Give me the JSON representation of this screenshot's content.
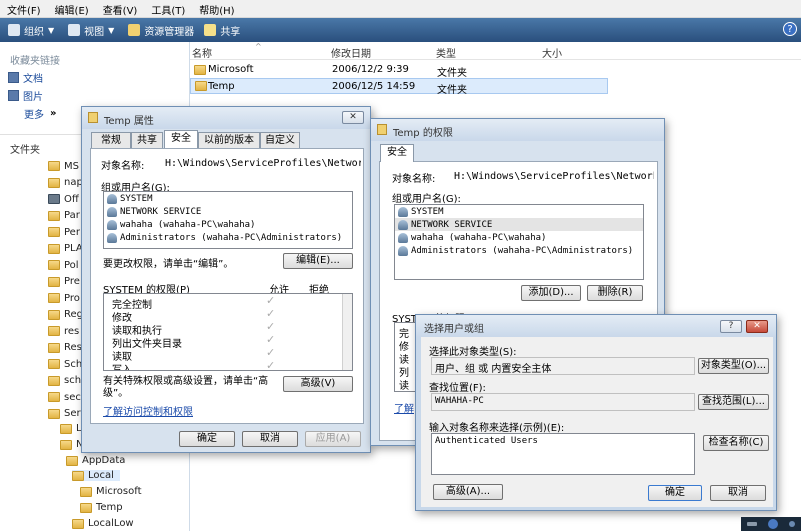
{
  "menubar": [
    "文件(F)",
    "编辑(E)",
    "查看(V)",
    "工具(T)",
    "帮助(H)"
  ],
  "toolbar": {
    "organize": "组织",
    "views": "视图",
    "explorer": "资源管理器",
    "share": "共享",
    "help": "?"
  },
  "left": {
    "favorites_header": "收藏夹链接",
    "favorites": [
      "文档",
      "图片",
      "更多"
    ],
    "more_arrows": "»",
    "folders_header": "文件夹",
    "tree": [
      "MS",
      "nap",
      "Off",
      "Par",
      "Per",
      "PLA",
      "Pol",
      "Pre",
      "Pro",
      "Reg",
      "res",
      "Res",
      "Sch",
      "sch",
      "sec",
      "Ser",
      "Lo",
      "N",
      "AppData",
      "Local",
      "Microsoft",
      "Temp",
      "LocalLow"
    ]
  },
  "filelist": {
    "columns": [
      "名称",
      "修改日期",
      "类型",
      "大小"
    ],
    "rows": [
      {
        "name": "Microsoft",
        "date": "2006/12/2 9:39",
        "type": "文件夹"
      },
      {
        "name": "Temp",
        "date": "2006/12/5 14:59",
        "type": "文件夹"
      }
    ]
  },
  "props": {
    "title": "Temp 属性",
    "close": "✕",
    "tabs": [
      "常规",
      "共享",
      "安全",
      "以前的版本",
      "自定义"
    ],
    "object_label": "对象名称:",
    "object_value": "H:\\Windows\\ServiceProfiles\\NetworkServic",
    "group_label": "组或用户名(G):",
    "users": [
      "SYSTEM",
      "NETWORK SERVICE",
      "wahaha (wahaha-PC\\wahaha)",
      "Administrators (wahaha-PC\\Administrators)"
    ],
    "change_text": "要更改权限，请单击“编辑”。",
    "edit_btn": "编辑(E)...",
    "perm_header": "SYSTEM 的权限(P)",
    "allow": "允许",
    "deny": "拒绝",
    "perms": [
      "完全控制",
      "修改",
      "读取和执行",
      "列出文件夹目录",
      "读取",
      "写入"
    ],
    "check": "✓",
    "advanced_text": "有关特殊权限或高级设置，请单击“高级”。",
    "advanced_btn": "高级(V)",
    "learn_link": "了解访问控制和权限",
    "ok": "确定",
    "cancel": "取消",
    "apply": "应用(A)"
  },
  "perm": {
    "title": "Temp 的权限",
    "tab": "安全",
    "object_label": "对象名称:",
    "object_value": "H:\\Windows\\ServiceProfiles\\NetworkServic",
    "group_label": "组或用户名(G):",
    "users": [
      "SYSTEM",
      "NETWORK SERVICE",
      "wahaha (wahaha-PC\\wahaha)",
      "Administrators (wahaha-PC\\Administrators)"
    ],
    "add_btn": "添加(D)...",
    "remove_btn": "删除(R)",
    "perm_header_partial": "SYSTEM 的权限",
    "perms_partial": [
      "完",
      "修",
      "读",
      "列",
      "读"
    ],
    "link_partial": "了解"
  },
  "select": {
    "title": "选择用户或组",
    "help": "?",
    "close": "✕",
    "type_label": "选择此对象类型(S):",
    "type_value": "用户、组 或 内置安全主体",
    "type_btn": "对象类型(O)...",
    "loc_label": "查找位置(F):",
    "loc_value": "WAHAHA-PC",
    "loc_btn": "查找范围(L)...",
    "name_label": "输入对象名称来选择(示例)(E):",
    "name_value": "Authenticated Users",
    "check_btn": "检查名称(C)",
    "advanced_btn": "高级(A)...",
    "ok": "确定",
    "cancel": "取消"
  }
}
